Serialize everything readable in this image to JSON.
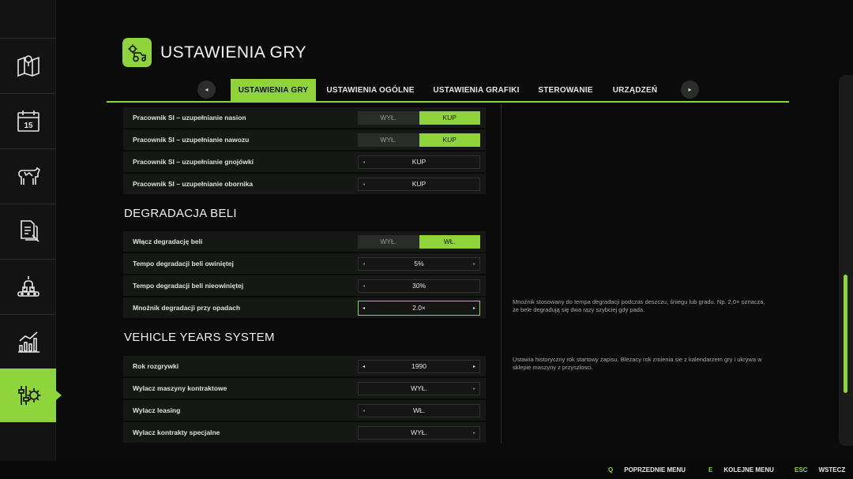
{
  "header": {
    "title": "USTAWIENIA GRY",
    "icon": "tractor-gear-icon"
  },
  "sidebar": {
    "items": [
      {
        "icon": "map-icon"
      },
      {
        "icon": "calendar-icon",
        "badge": "15"
      },
      {
        "icon": "cow-icon"
      },
      {
        "icon": "documents-icon"
      },
      {
        "icon": "production-icon"
      },
      {
        "icon": "statistics-icon"
      },
      {
        "icon": "settings-icon",
        "active": true
      }
    ]
  },
  "tabs": {
    "prev": "◂",
    "next": "▸",
    "items": [
      {
        "label": "USTAWIENIA GRY",
        "active": true
      },
      {
        "label": "USTAWIENIA OGÓLNE"
      },
      {
        "label": "USTAWIENIA GRAFIKI"
      },
      {
        "label": "STEROWANIE"
      },
      {
        "label": "URZĄDZEŃ"
      }
    ]
  },
  "settings": {
    "group1": [
      {
        "label": "Pracownik SI – uzupełnianie nasion",
        "type": "toggle",
        "options": [
          "WYŁ.",
          "KUP"
        ],
        "selected": 1
      },
      {
        "label": "Pracownik SI – uzupełnianie nawozu",
        "type": "toggle",
        "options": [
          "WYŁ.",
          "KUP"
        ],
        "selected": 1
      },
      {
        "label": "Pracownik SI – uzupełnianie gnojówki",
        "type": "selector",
        "value": "KUP"
      },
      {
        "label": "Pracownik SI – uzupełnianie obornika",
        "type": "selector",
        "value": "KUP"
      }
    ],
    "section_bale": "DEGRADACJA BELI",
    "group2": [
      {
        "label": "Włącz degradację beli",
        "type": "toggle",
        "options": [
          "WYŁ.",
          "WŁ."
        ],
        "selected": 1
      },
      {
        "label": "Tempo degradacji beli owiniętej",
        "type": "selector",
        "value": "5%"
      },
      {
        "label": "Tempo degradacji beli nieowiniętej",
        "type": "selector",
        "value": "30%"
      },
      {
        "label": "Mnożnik degradacji przy opadach",
        "type": "selector",
        "value": "2.0×",
        "focused": true
      }
    ],
    "section_vehicle": "VEHICLE YEARS SYSTEM",
    "group3": [
      {
        "label": "Rok rozgrywki",
        "type": "selector",
        "value": "1990",
        "focused_arrows": true
      },
      {
        "label": "Wylacz maszyny kontraktowe",
        "type": "selector",
        "value": "WYŁ."
      },
      {
        "label": "Wylacz leasing",
        "type": "selector",
        "value": "WŁ."
      },
      {
        "label": "Wylacz kontrakty specjalne",
        "type": "selector",
        "value": "WYŁ."
      }
    ]
  },
  "descriptions": {
    "bale_multiplier": "Mnożnik stosowany do tempa degradacji podczas deszczu, śniegu lub gradu. Np. 2,0× oznacza, że bele degradują się dwa razy szybciej gdy pada.",
    "game_year": "Ustawia historyczny rok startowy zapisu. Blezacy rok zmienia sie z kalendarzem gry i ukrywa w sklepie maszyny z przyszlosci."
  },
  "footer": {
    "hints": [
      {
        "key": "Q",
        "label": "POPRZEDNIE MENU"
      },
      {
        "key": "E",
        "label": "KOLEJNE MENU"
      },
      {
        "key": "ESC",
        "label": "WSTECZ"
      }
    ]
  },
  "colors": {
    "accent": "#8fd43a",
    "background": "#0a0b0a",
    "row": "#161816"
  }
}
